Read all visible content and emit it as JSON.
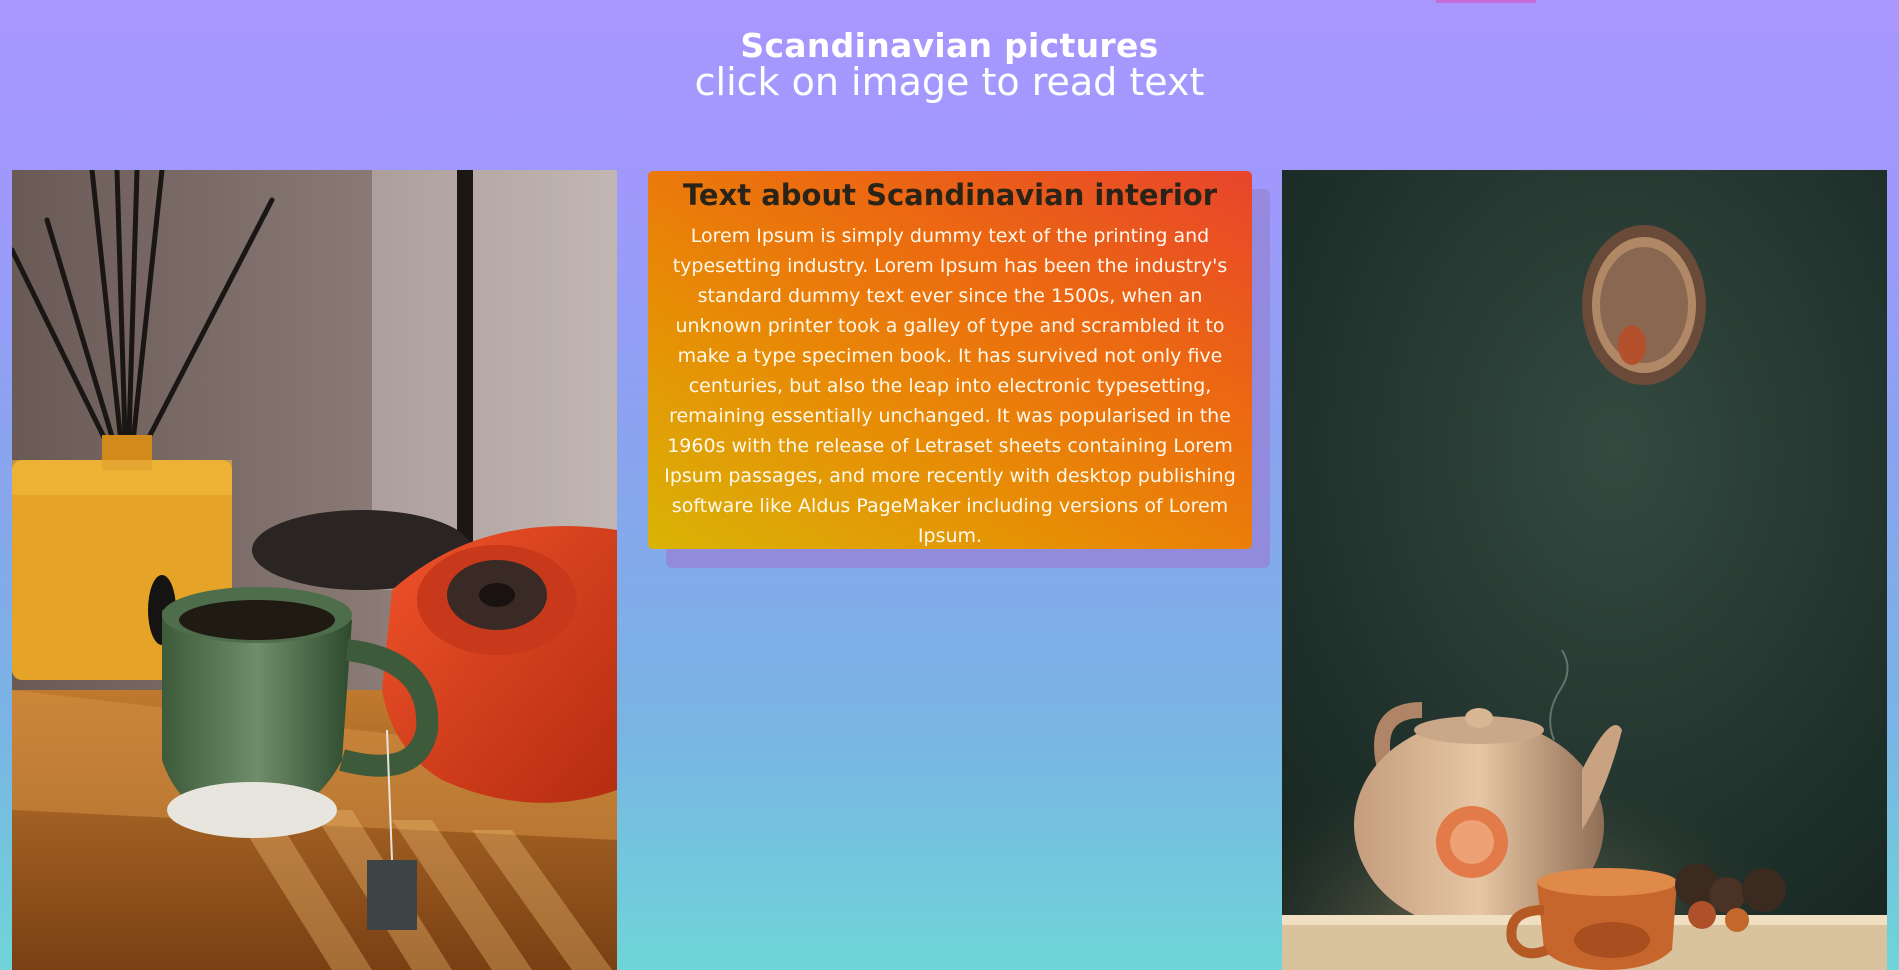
{
  "header": {
    "title": "Scandinavian pictures",
    "subtitle": "click on image to read text"
  },
  "gallery": {
    "left_image": {
      "label": "Scandinavian interior photo: green cup, red rotary telephone, yellow diffuser",
      "icon": "photo-icon"
    },
    "right_image": {
      "label": "Scandinavian interior photo: teapot and orange cup on table",
      "icon": "photo-icon"
    }
  },
  "card": {
    "title": "Text about Scandinavian interior",
    "body": "Lorem Ipsum is simply dummy text of the printing and typesetting industry. Lorem Ipsum has been the industry's standard dummy text ever since the 1500s, when an unknown printer took a galley of type and scrambled it to make a type specimen book. It has survived not only five centuries, but also the leap into electronic typesetting, remaining essentially unchanged. It was popularised in the 1960s with the release of Letraset sheets containing Lorem Ipsum passages, and more recently with desktop publishing software like Aldus PageMaker including versions of Lorem Ipsum."
  },
  "colors": {
    "background_top": "#a897fe",
    "background_bottom": "#6fd5d8",
    "card_gradient_start": "#d9b406",
    "card_gradient_end": "#e8442c",
    "card_shadow": "#9486d8",
    "title_text": "#ffffff",
    "card_title_text": "#2a2418"
  }
}
